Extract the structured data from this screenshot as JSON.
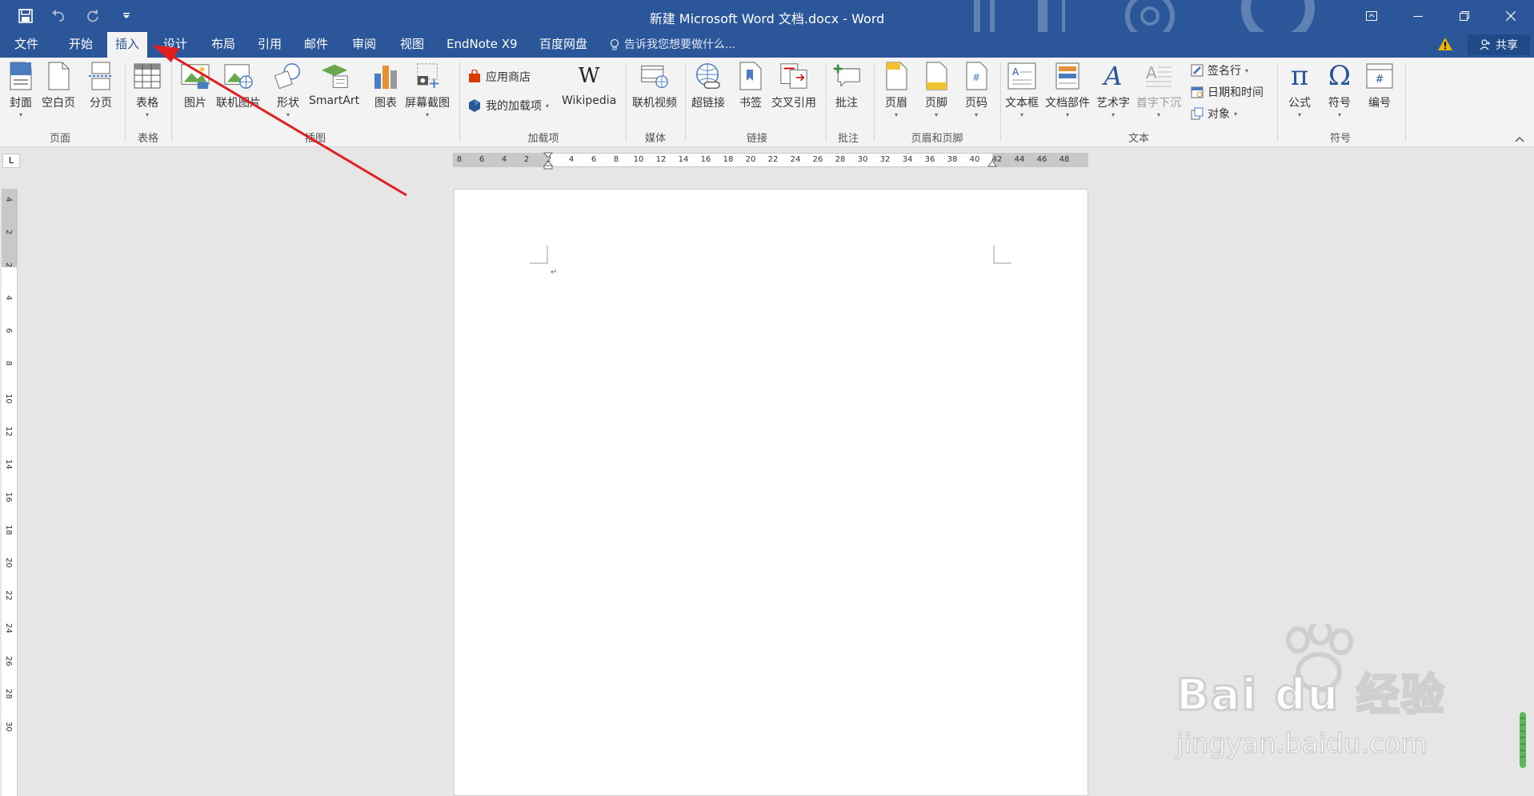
{
  "titlebar": {
    "title": "新建 Microsoft Word 文档.docx - Word",
    "quick_access": [
      "save-icon",
      "undo-icon",
      "redo-icon",
      "customize-icon"
    ],
    "window_controls": [
      "ribbon-display-icon",
      "minimize-icon",
      "restore-icon",
      "close-icon"
    ]
  },
  "tabs": {
    "items": [
      "文件",
      "开始",
      "插入",
      "设计",
      "布局",
      "引用",
      "邮件",
      "审阅",
      "视图",
      "EndNote X9",
      "百度网盘"
    ],
    "active": "插入",
    "tell_me": "告诉我您想要做什么...",
    "share": "共享"
  },
  "ribbon": {
    "page": {
      "label": "页面",
      "buttons": [
        "封面",
        "空白页",
        "分页"
      ]
    },
    "table": {
      "label": "表格",
      "buttons": [
        "表格"
      ]
    },
    "illustrations": {
      "label": "插图",
      "buttons": [
        "图片",
        "联机图片",
        "形状",
        "SmartArt",
        "图表",
        "屏幕截图"
      ]
    },
    "addins": {
      "label": "加载项",
      "store": "应用商店",
      "my_addins": "我的加载项",
      "wikipedia": "Wikipedia"
    },
    "media": {
      "label": "媒体",
      "buttons": [
        "联机视频"
      ]
    },
    "links": {
      "label": "链接",
      "buttons": [
        "超链接",
        "书签",
        "交叉引用"
      ]
    },
    "comments": {
      "label": "批注",
      "buttons": [
        "批注"
      ]
    },
    "header_footer": {
      "label": "页眉和页脚",
      "buttons": [
        "页眉",
        "页脚",
        "页码"
      ]
    },
    "text": {
      "label": "文本",
      "buttons": [
        "文本框",
        "文档部件",
        "艺术字",
        "首字下沉"
      ],
      "signature": "签名行",
      "datetime": "日期和时间",
      "object": "对象"
    },
    "symbols": {
      "label": "符号",
      "buttons": [
        "公式",
        "符号",
        "编号"
      ]
    }
  },
  "ruler": {
    "horizontal": [
      "8",
      "6",
      "4",
      "2",
      "2",
      "4",
      "6",
      "8",
      "10",
      "12",
      "14",
      "16",
      "18",
      "20",
      "22",
      "24",
      "26",
      "28",
      "30",
      "32",
      "34",
      "36",
      "38",
      "40",
      "42",
      "44",
      "46",
      "48"
    ],
    "vertical": [
      "4",
      "2",
      "2",
      "4",
      "6",
      "8",
      "10",
      "12",
      "14",
      "16",
      "18",
      "20",
      "22",
      "24",
      "26",
      "28",
      "30"
    ],
    "corner": "L"
  },
  "watermark": {
    "brand": "Bai du 经验",
    "url": "jingyan.baidu.com"
  },
  "colors": {
    "title_blue": "#2b579a",
    "ribbon_bg": "#f3f3f3",
    "annotation_red": "#e02020"
  }
}
